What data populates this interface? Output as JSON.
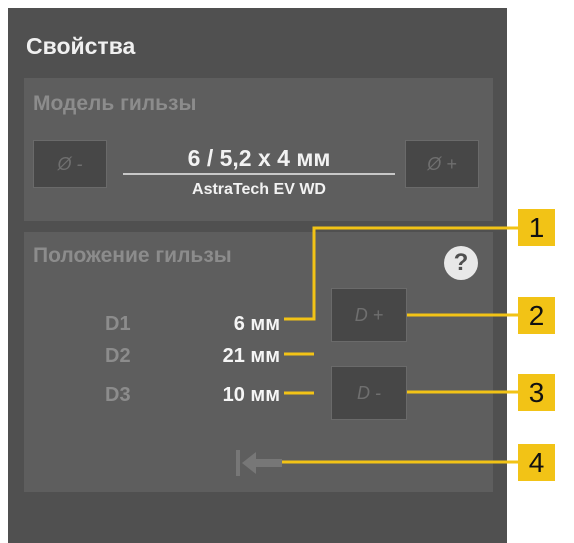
{
  "panel": {
    "title": "Свойства"
  },
  "sleeve_model": {
    "title": "Модель гильзы",
    "decrease_label": "Ø -",
    "increase_label": "Ø +",
    "size": "6 / 5,2 x 4 мм",
    "product": "AstraTech EV WD"
  },
  "sleeve_position": {
    "title": "Положение гильзы",
    "help_label": "?",
    "rows": [
      {
        "label": "D1",
        "value": "6 мм"
      },
      {
        "label": "D2",
        "value": "21 мм"
      },
      {
        "label": "D3",
        "value": "10 мм"
      }
    ],
    "d_plus_label": "D +",
    "d_minus_label": "D -"
  },
  "callouts": [
    "1",
    "2",
    "3",
    "4"
  ],
  "colors": {
    "callout": "#f2c316",
    "panel": "#505050",
    "group": "#5e5e5e"
  },
  "icons": {
    "reset": "arrow-to-left-bar-icon"
  }
}
